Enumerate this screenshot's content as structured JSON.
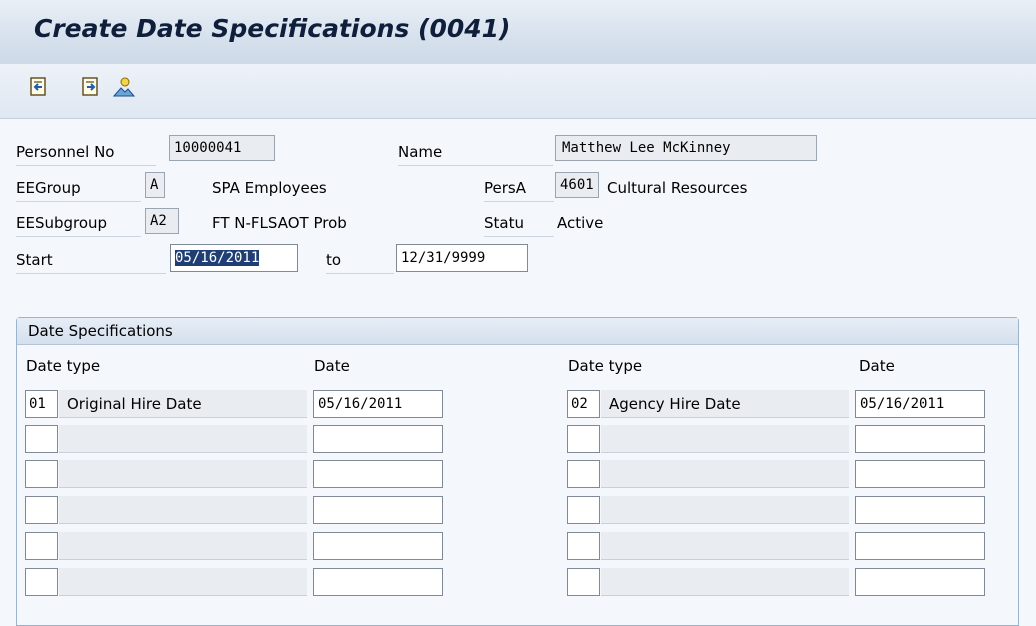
{
  "title": "Create Date Specifications (0041)",
  "toolbar": {
    "icons": [
      "previous-record-icon",
      "next-record-icon",
      "overview-icon"
    ]
  },
  "header": {
    "personnel_no_label": "Personnel No",
    "personnel_no_value": "10000041",
    "name_label": "Name",
    "name_value": "Matthew Lee McKinney",
    "eegroup_label": "EEGroup",
    "eegroup_code": "A",
    "eegroup_text": "SPA Employees",
    "persa_label": "PersA",
    "persa_code": "4601",
    "persa_text": "Cultural Resources",
    "eesubgroup_label": "EESubgroup",
    "eesubgroup_code": "A2",
    "eesubgroup_text": "FT N-FLSAOT Prob",
    "status_label": "Statu",
    "status_value": "Active",
    "start_label": "Start",
    "start_value": "05/16/2011",
    "to_label": "to",
    "end_value": "12/31/9999"
  },
  "date_specs": {
    "group_title": "Date Specifications",
    "col_date_type": "Date type",
    "col_date": "Date",
    "left_rows": [
      {
        "code": "01",
        "text": "Original Hire Date",
        "date": "05/16/2011"
      },
      {
        "code": "",
        "text": "",
        "date": ""
      },
      {
        "code": "",
        "text": "",
        "date": ""
      },
      {
        "code": "",
        "text": "",
        "date": ""
      },
      {
        "code": "",
        "text": "",
        "date": ""
      },
      {
        "code": "",
        "text": "",
        "date": ""
      }
    ],
    "right_rows": [
      {
        "code": "02",
        "text": "Agency Hire Date",
        "date": "05/16/2011"
      },
      {
        "code": "",
        "text": "",
        "date": ""
      },
      {
        "code": "",
        "text": "",
        "date": ""
      },
      {
        "code": "",
        "text": "",
        "date": ""
      },
      {
        "code": "",
        "text": "",
        "date": ""
      },
      {
        "code": "",
        "text": "",
        "date": ""
      }
    ]
  },
  "colors": {
    "title_bar": "#d8e2ee",
    "selection": "#1f3f74",
    "group_border": "#9db2cd"
  }
}
